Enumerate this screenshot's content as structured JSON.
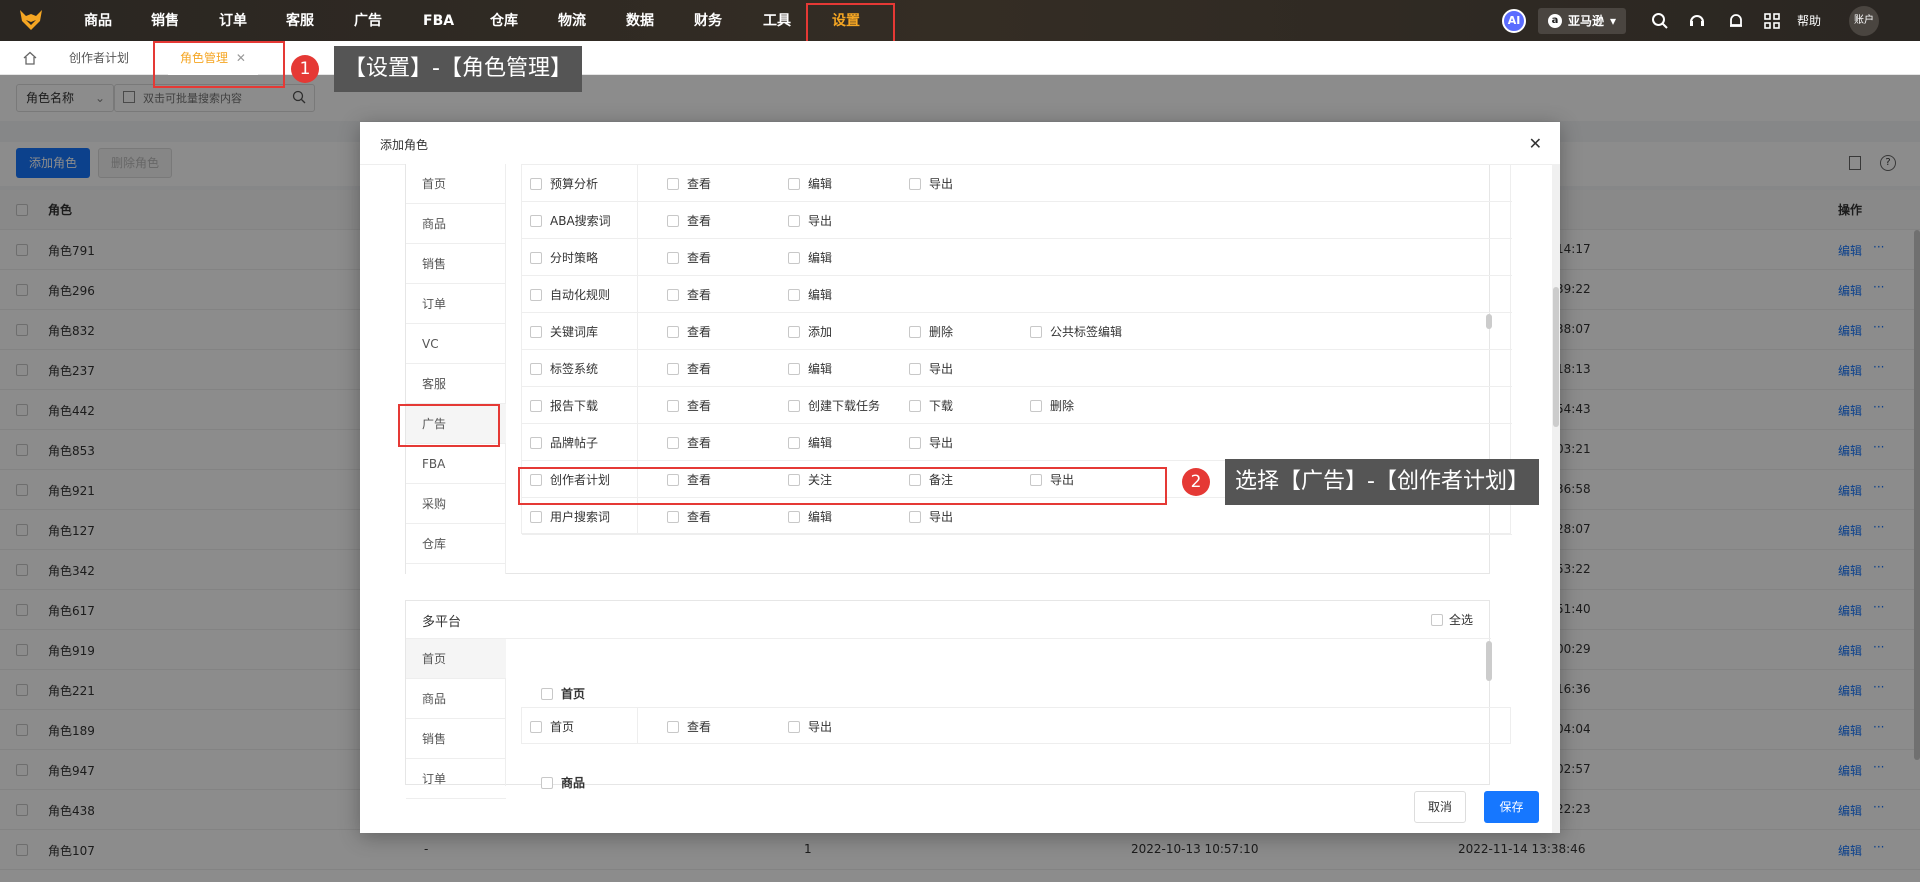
{
  "nav": {
    "items": [
      "商品",
      "销售",
      "订单",
      "客服",
      "广告",
      "FBA",
      "仓库",
      "物流",
      "数据",
      "财务",
      "工具",
      "设置"
    ],
    "active": "设置",
    "ai": "AI",
    "marketplace": "亚马逊",
    "help": "帮助",
    "account": "账户"
  },
  "tabs": {
    "items": [
      "创作者计划",
      "角色管理"
    ]
  },
  "filter": {
    "field": "角色名称",
    "placeholder": "双击可批量搜索内容"
  },
  "buttons": {
    "add": "添加角色",
    "delete": "删除角色"
  },
  "table": {
    "col_role": "角色",
    "col_action": "操作",
    "edit_label": "编辑",
    "more": "···",
    "rows": [
      {
        "name": "角色791",
        "time": "14:17"
      },
      {
        "name": "角色296",
        "time": "39:22"
      },
      {
        "name": "角色832",
        "time": "38:07"
      },
      {
        "name": "角色237",
        "time": "18:13"
      },
      {
        "name": "角色442",
        "time": "54:43"
      },
      {
        "name": "角色853",
        "time": "03:21"
      },
      {
        "name": "角色921",
        "time": "36:58"
      },
      {
        "name": "角色127",
        "time": "28:07"
      },
      {
        "name": "角色342",
        "time": "53:22"
      },
      {
        "name": "角色617",
        "time": "51:40"
      },
      {
        "name": "角色919",
        "time": "00:29"
      },
      {
        "name": "角色221",
        "time": "16:36"
      },
      {
        "name": "角色189",
        "time": "04:04"
      },
      {
        "name": "角色947",
        "time": "02:57"
      },
      {
        "name": "角色438",
        "time": "22:23"
      }
    ],
    "last_row": {
      "name": "角色107",
      "c2": "-",
      "c3": "1",
      "created": "2022-10-13 10:57:10",
      "updated": "2022-11-14 13:38:46"
    }
  },
  "dialog": {
    "title": "添加角色",
    "cancel": "取消",
    "save": "保存",
    "sidebar1": [
      "首页",
      "商品",
      "销售",
      "订单",
      "VC",
      "客服",
      "广告",
      "FBA",
      "采购",
      "仓库"
    ],
    "perm_rows": [
      {
        "name": "预算分析",
        "perms": [
          "查看",
          "编辑",
          "导出"
        ]
      },
      {
        "name": "ABA搜索词",
        "perms": [
          "查看",
          "导出"
        ]
      },
      {
        "name": "分时策略",
        "perms": [
          "查看",
          "编辑"
        ]
      },
      {
        "name": "自动化规则",
        "perms": [
          "查看",
          "编辑"
        ]
      },
      {
        "name": "关键词库",
        "perms": [
          "查看",
          "添加",
          "删除",
          "公共标签编辑"
        ]
      },
      {
        "name": "标签系统",
        "perms": [
          "查看",
          "编辑",
          "导出"
        ]
      },
      {
        "name": "报告下载",
        "perms": [
          "查看",
          "创建下载任务",
          "下载",
          "删除"
        ]
      },
      {
        "name": "品牌帖子",
        "perms": [
          "查看",
          "编辑",
          "导出"
        ]
      },
      {
        "name": "创作者计划",
        "perms": [
          "查看",
          "关注",
          "备注",
          "导出"
        ]
      },
      {
        "name": "用户搜索词",
        "perms": [
          "查看",
          "编辑",
          "导出"
        ]
      }
    ],
    "multi": {
      "title": "多平台",
      "select_all": "全选",
      "sidebar": [
        "首页",
        "商品",
        "销售",
        "订单"
      ],
      "group1": "首页",
      "row1": {
        "name": "首页",
        "perms": [
          "查看",
          "导出"
        ]
      },
      "group2": "商品"
    }
  },
  "callouts": {
    "c1_num": "1",
    "c1_text": "【设置】-【角色管理】",
    "c2_num": "2",
    "c2_text": "选择【广告】-【创作者计划】"
  },
  "colors": {
    "accent": "#1677ff",
    "nav_active": "#f5a623",
    "annotation": "#e53935"
  }
}
